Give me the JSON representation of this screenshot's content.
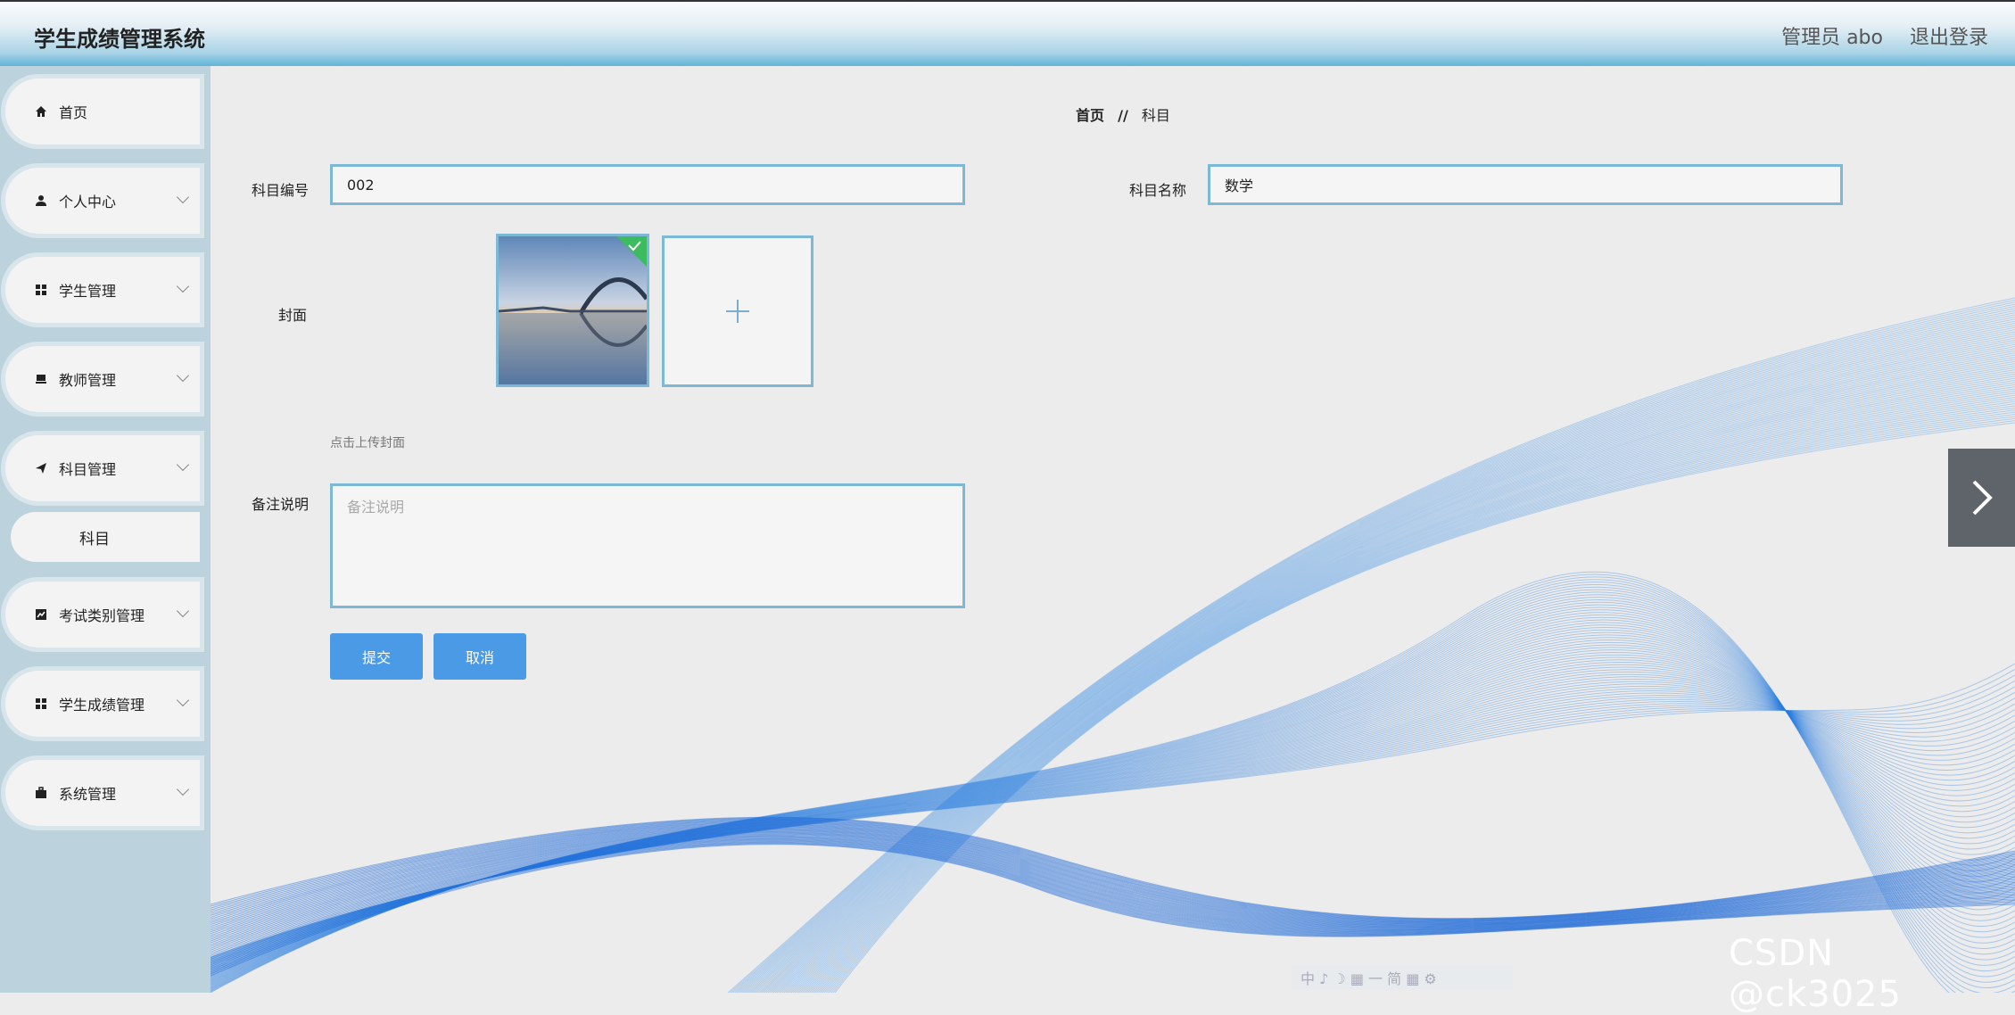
{
  "header": {
    "title": "学生成绩管理系统",
    "user": "管理员 abo",
    "logout": "退出登录"
  },
  "sidebar": {
    "items": [
      {
        "label": "首页",
        "icon": "home-icon"
      },
      {
        "label": "个人中心",
        "icon": "user-icon"
      },
      {
        "label": "学生管理",
        "icon": "grid-icon"
      },
      {
        "label": "教师管理",
        "icon": "monitor-icon"
      },
      {
        "label": "科目管理",
        "icon": "send-icon"
      },
      {
        "label": "考试类别管理",
        "icon": "chart-icon"
      },
      {
        "label": "学生成绩管理",
        "icon": "grid-icon"
      },
      {
        "label": "系统管理",
        "icon": "briefcase-icon"
      }
    ],
    "sub_item": "科目"
  },
  "breadcrumb": {
    "home": "首页",
    "separator": "//",
    "current": "科目"
  },
  "form": {
    "code_label": "科目编号",
    "code_value": "002",
    "name_label": "科目名称",
    "name_value": "数学",
    "cover_label": "封面",
    "cover_hint": "点击上传封面",
    "note_label": "备注说明",
    "note_placeholder": "备注说明",
    "submit": "提交",
    "cancel": "取消"
  },
  "watermark": "CSDN @ck3025",
  "toolbar_hint": "中 ♪ ☽ ▦ 一 简 ▦ ⚙",
  "colors": {
    "accent": "#4a9ae6",
    "border": "#7cb9d6",
    "sidebar_bg": "#bcd2dc"
  }
}
